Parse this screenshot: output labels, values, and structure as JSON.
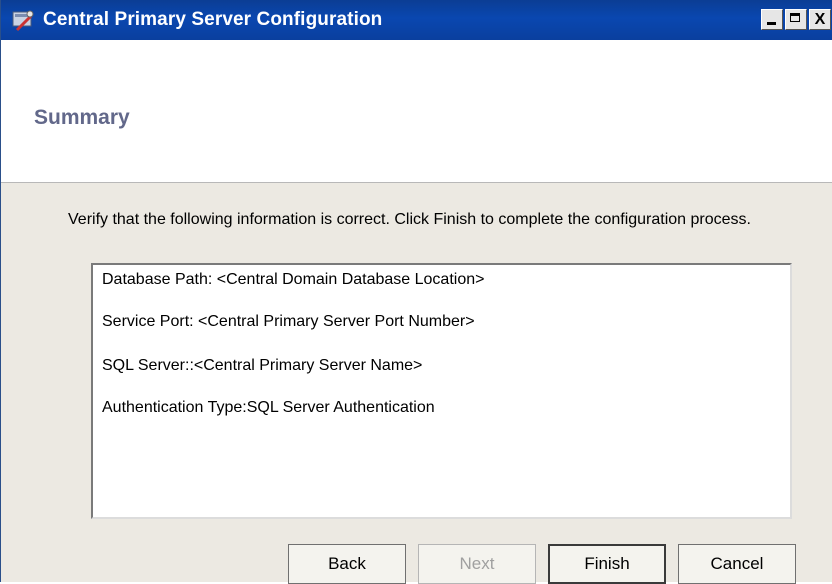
{
  "window": {
    "title": "Central Primary Server Configuration",
    "controls": {
      "close_label": "X"
    }
  },
  "header": {
    "title": "Summary"
  },
  "content": {
    "instruction": "Verify that the following information is correct. Click Finish to complete the configuration process.",
    "summary_lines": [
      "Database Path: <Central Domain Database Location>",
      "Service Port: <Central Primary Server Port Number>",
      "SQL Server::<Central Primary Server Name>",
      "Authentication Type:SQL Server Authentication"
    ]
  },
  "buttons": {
    "back": "Back",
    "next": "Next",
    "finish": "Finish",
    "cancel": "Cancel"
  },
  "colors": {
    "titlebar": "#0a47b0",
    "header_title": "#62688a",
    "background": "#ece9e2"
  }
}
